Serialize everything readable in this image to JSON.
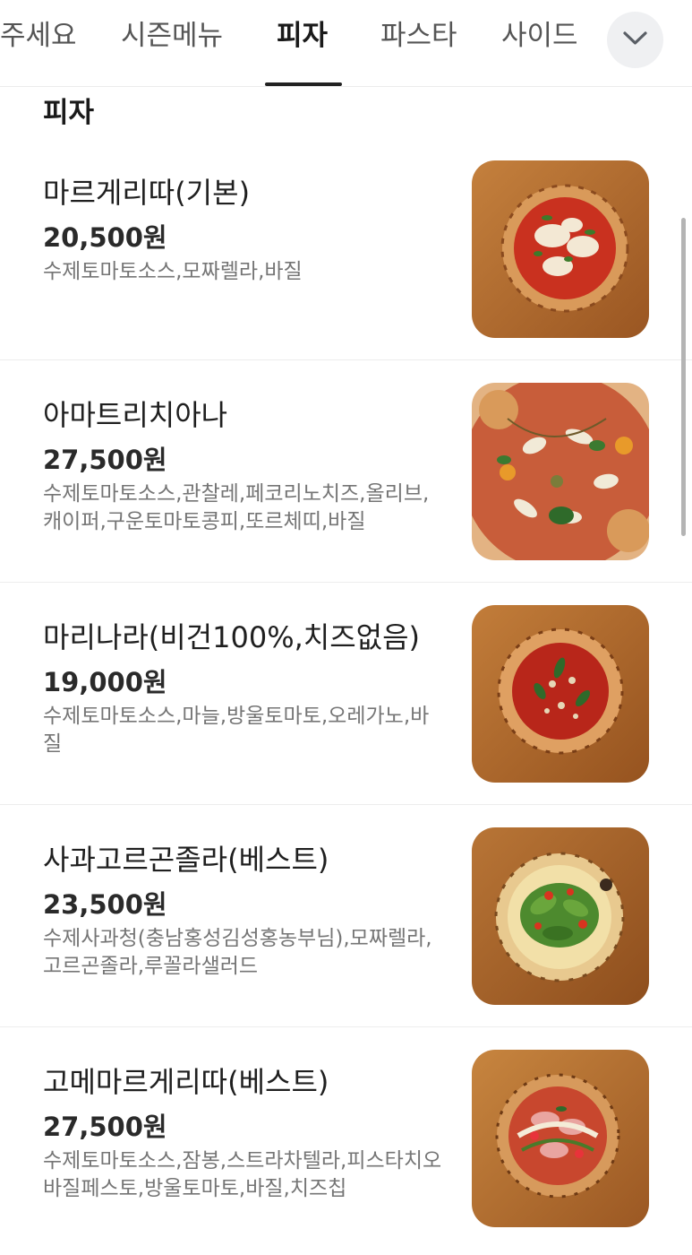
{
  "tabs": [
    {
      "label": "주세요"
    },
    {
      "label": "시즌메뉴"
    },
    {
      "label": "피자",
      "active": true
    },
    {
      "label": "파스타"
    },
    {
      "label": "사이드"
    }
  ],
  "more_icon": "chevron-down-icon",
  "section_title": "피자",
  "items": [
    {
      "name": "마르게리따(기본)",
      "price": "20,500원",
      "desc": "수제토마토소스,모짜렐라,바질",
      "image": "margherita-pizza-photo"
    },
    {
      "name": "아마트리치아나",
      "price": "27,500원",
      "desc": "수제토마토소스,관찰레,페코리노치즈,올리브,캐이퍼,구운토마토콩피,또르체띠,바질",
      "image": "amatriciana-pizza-photo"
    },
    {
      "name": "마리나라(비건100%,치즈없음)",
      "price": "19,000원",
      "desc": "수제토마토소스,마늘,방울토마토,오레가노,바질",
      "image": "marinara-pizza-photo"
    },
    {
      "name": "사과고르곤졸라(베스트)",
      "price": "23,500원",
      "desc": "수제사과청(충남홍성김성홍농부님),모짜렐라,고르곤졸라,루꼴라샐러드",
      "image": "apple-gorgonzola-pizza-photo"
    },
    {
      "name": "고메마르게리따(베스트)",
      "price": "27,500원",
      "desc": "수제토마토소스,잠봉,스트라차텔라,피스타치오바질페스토,방울토마토,바질,치즈칩",
      "image": "gourmet-margherita-pizza-photo"
    }
  ],
  "colors": {
    "active_tab": "#1a1a1a",
    "inactive_tab": "#555555",
    "desc": "#757575",
    "wood": "#b06a2c"
  }
}
